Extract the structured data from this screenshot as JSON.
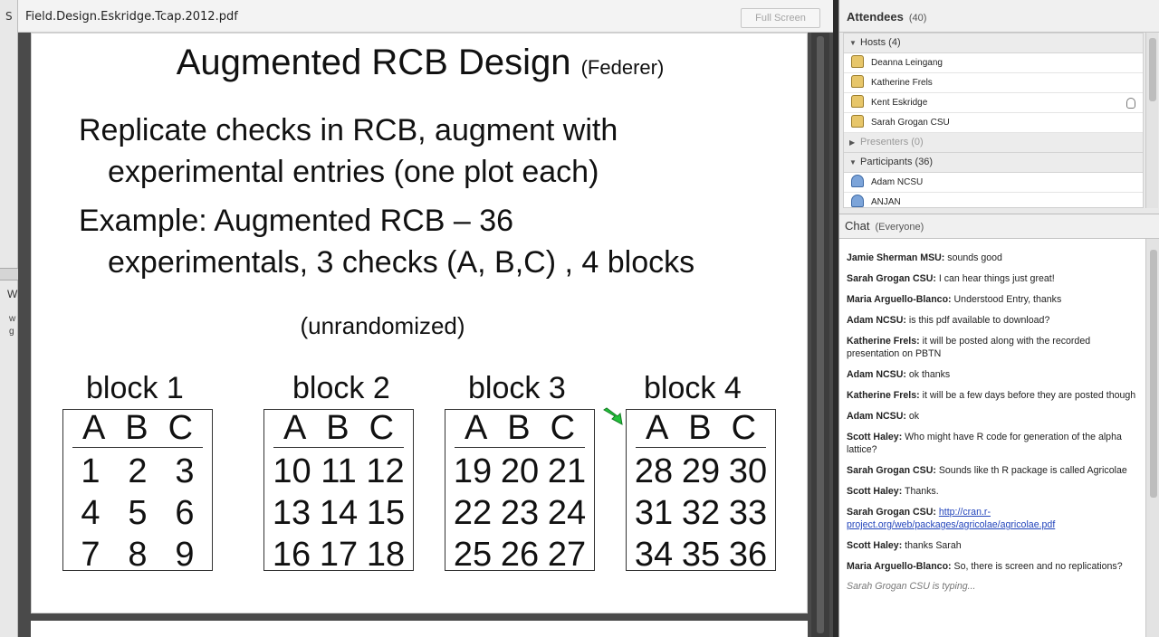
{
  "window": {
    "file_name": "Field.Design.Eskridge.Tcap.2012.pdf",
    "full_screen_label": "Full Screen"
  },
  "background_window": {
    "s": "S",
    "w": "W",
    "wg": "w\ng"
  },
  "slide": {
    "title": "Augmented RCB Design",
    "title_suffix": "(Federer)",
    "bullet1_line1": "Replicate checks in RCB, augment with",
    "bullet1_line2": "experimental entries (one plot each)",
    "bullet2_line1": "Example:  Augmented RCB – 36",
    "bullet2_line2": "experimentals, 3 checks (A, B,C) , 4 blocks",
    "note": "(unrandomized)",
    "blocks": [
      {
        "label": "block   1",
        "checks": [
          "A",
          "B",
          "C"
        ],
        "rows": [
          [
            "1",
            "2",
            "3"
          ],
          [
            "4",
            "5",
            "6"
          ],
          [
            "7",
            "8",
            "9"
          ]
        ]
      },
      {
        "label": "block 2",
        "checks": [
          "A",
          "B",
          "C"
        ],
        "rows": [
          [
            "10",
            "11",
            "12"
          ],
          [
            "13",
            "14",
            "15"
          ],
          [
            "16",
            "17",
            "18"
          ]
        ]
      },
      {
        "label": "block 3",
        "checks": [
          "A",
          "B",
          "C"
        ],
        "rows": [
          [
            "19",
            "20",
            "21"
          ],
          [
            "22",
            "23",
            "24"
          ],
          [
            "25",
            "26",
            "27"
          ]
        ]
      },
      {
        "label": "block 4",
        "checks": [
          "A",
          "B",
          "C"
        ],
        "rows": [
          [
            "28",
            "29",
            "30"
          ],
          [
            "31",
            "32",
            "33"
          ],
          [
            "34",
            "35",
            "36"
          ]
        ]
      }
    ]
  },
  "attendees": {
    "title": "Attendees",
    "count": "(40)",
    "hosts_label": "Hosts (4)",
    "hosts": [
      "Deanna Leingang",
      "Katherine Frels",
      "Kent Eskridge",
      "Sarah Grogan CSU"
    ],
    "presenters_label": "Presenters (0)",
    "participants_label": "Participants (36)",
    "participants": [
      "Adam NCSU",
      "ANJAN"
    ]
  },
  "chat": {
    "title": "Chat",
    "scope": "(Everyone)",
    "messages": [
      {
        "name": "Jamie Sherman MSU:",
        "text": " sounds good"
      },
      {
        "name": "Sarah Grogan CSU:",
        "text": " I can hear things just great!"
      },
      {
        "name": "Maria Arguello-Blanco:",
        "text": " Understood Entry, thanks"
      },
      {
        "name": "Adam NCSU:",
        "text": " is this pdf available to download?"
      },
      {
        "name": "Katherine Frels:",
        "text": " it will be posted along with the recorded presentation on PBTN"
      },
      {
        "name": "Adam NCSU:",
        "text": " ok thanks"
      },
      {
        "name": "Katherine Frels:",
        "text": " it will be a few days before they are posted though"
      },
      {
        "name": "Adam NCSU:",
        "text": " ok"
      },
      {
        "name": "Scott Haley:",
        "text": " Who might have R code for generation of the alpha lattice?"
      },
      {
        "name": "Sarah Grogan CSU:",
        "text": " Sounds like th R package is called Agricolae"
      },
      {
        "name": "Scott Haley:",
        "text": " Thanks."
      },
      {
        "name": "Sarah Grogan CSU:",
        "text": " ",
        "link": "http://cran.r-project.org/web/packages/agricolae/agricolae.pdf"
      },
      {
        "name": "Scott Haley:",
        "text": " thanks Sarah"
      },
      {
        "name": "Maria Arguello-Blanco:",
        "text": " So, there is screen and no replications?"
      }
    ],
    "typing": "Sarah Grogan CSU is typing..."
  }
}
